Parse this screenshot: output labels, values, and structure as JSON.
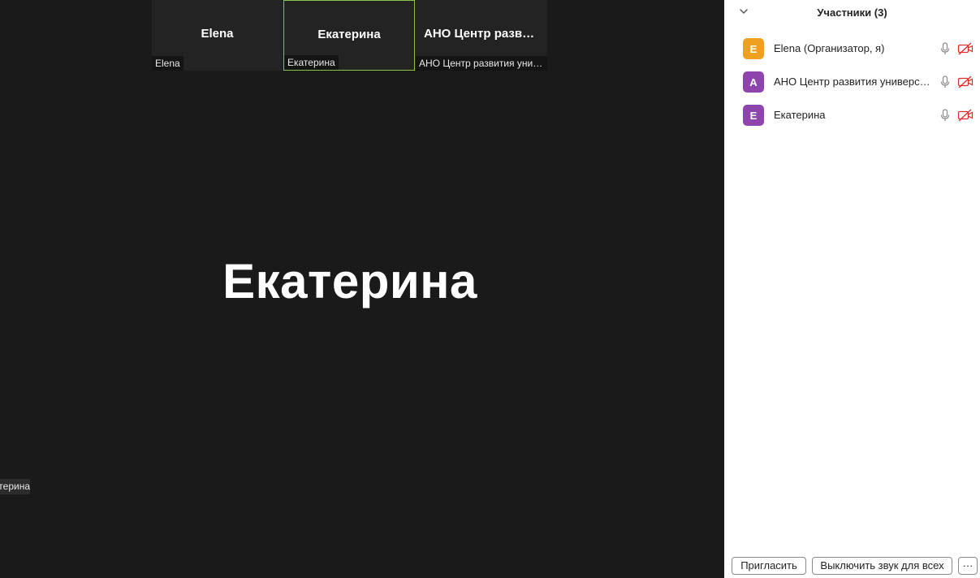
{
  "gallery": {
    "thumbnails": [
      {
        "name": "Elena",
        "label": "Elena"
      },
      {
        "name": "Екатерина",
        "label": "Екатерина"
      },
      {
        "name": "АНО Центр развития универсальных компетенций",
        "label": "АНО Центр развития универсальных компетенций"
      }
    ]
  },
  "main_video": {
    "name": "Екатерина",
    "label": "Екатерина"
  },
  "participants_panel": {
    "title": "Участники (3)",
    "participants": [
      {
        "initial": "E",
        "name": "Elena (Организатор, я)",
        "avatar_color": "#f0a020",
        "mic_icon": "mic-icon",
        "video_icon": "video-off-icon"
      },
      {
        "initial": "А",
        "name": "АНО Центр развития универсальных компетенций",
        "avatar_color": "#8e44ad",
        "mic_icon": "mic-icon",
        "video_icon": "video-off-icon"
      },
      {
        "initial": "Е",
        "name": "Екатерина",
        "avatar_color": "#8e44ad",
        "mic_icon": "mic-icon",
        "video_icon": "video-off-icon"
      }
    ],
    "invite_button": "Пригласить",
    "mute_all_button": "Выключить звук для всех",
    "more_button": "···"
  },
  "colors": {
    "active_speaker_border": "#8bc34a",
    "video_off_red": "#e02b2b",
    "background": "#1a1a1a"
  }
}
